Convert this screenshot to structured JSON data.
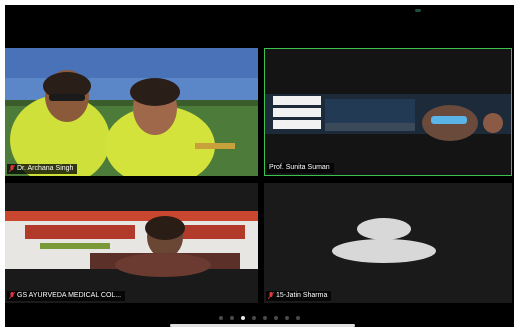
{
  "participants": [
    {
      "name": "Dr. Archana Singh",
      "muted": true,
      "active_speaker": false
    },
    {
      "name": "Prof. Sunita Suman",
      "muted": false,
      "active_speaker": true
    },
    {
      "name": "GS AYURVEDA MEDICAL COL...",
      "muted": true,
      "active_speaker": false
    },
    {
      "name": "15-Jatin Sharma",
      "muted": true,
      "active_speaker": false
    }
  ],
  "pagination": {
    "total_pages": 8,
    "current_page": 3
  },
  "colors": {
    "active_speaker_border": "#3bc24e",
    "mute_icon": "#e0383a",
    "background": "#000000"
  }
}
